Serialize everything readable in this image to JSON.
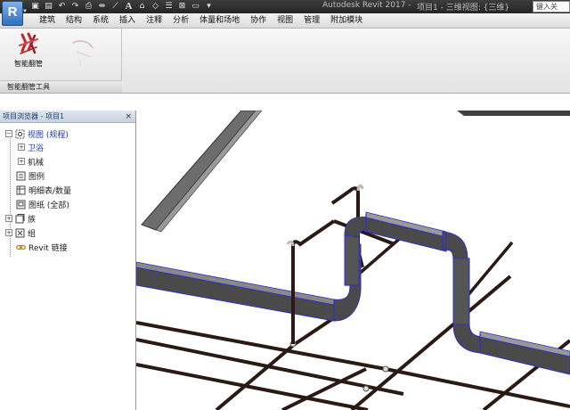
{
  "titlebar": {
    "app_letter": "R",
    "app_title": "Autodesk Revit 2017 -",
    "project_title": "项目1 - 三维视图: {三维}",
    "search_placeholder": "键入关"
  },
  "menu": {
    "tabs": [
      "建筑",
      "结构",
      "系统",
      "插入",
      "注释",
      "分析",
      "体量和场地",
      "协作",
      "视图",
      "管理",
      "附加模块"
    ]
  },
  "ribbon": {
    "button_label": "智能翻管",
    "panel_title": "智能翻管工具"
  },
  "browser": {
    "title": "项目浏览器 - 项目1",
    "close_glyph": "×",
    "items": {
      "views": "视图 (规程)",
      "plumbing": "卫浴",
      "mechanical": "机械",
      "legends": "图例",
      "schedules": "明细表/数量",
      "sheets": "图纸 (全部)",
      "families": "族",
      "groups": "组",
      "revit_links": "Revit 链接"
    }
  },
  "colors": {
    "duct_fill": "#4a4a4a",
    "duct_edge": "#2e2ec8",
    "pipe": "#2b1a14",
    "browser_selected": "#1d3fa8"
  }
}
